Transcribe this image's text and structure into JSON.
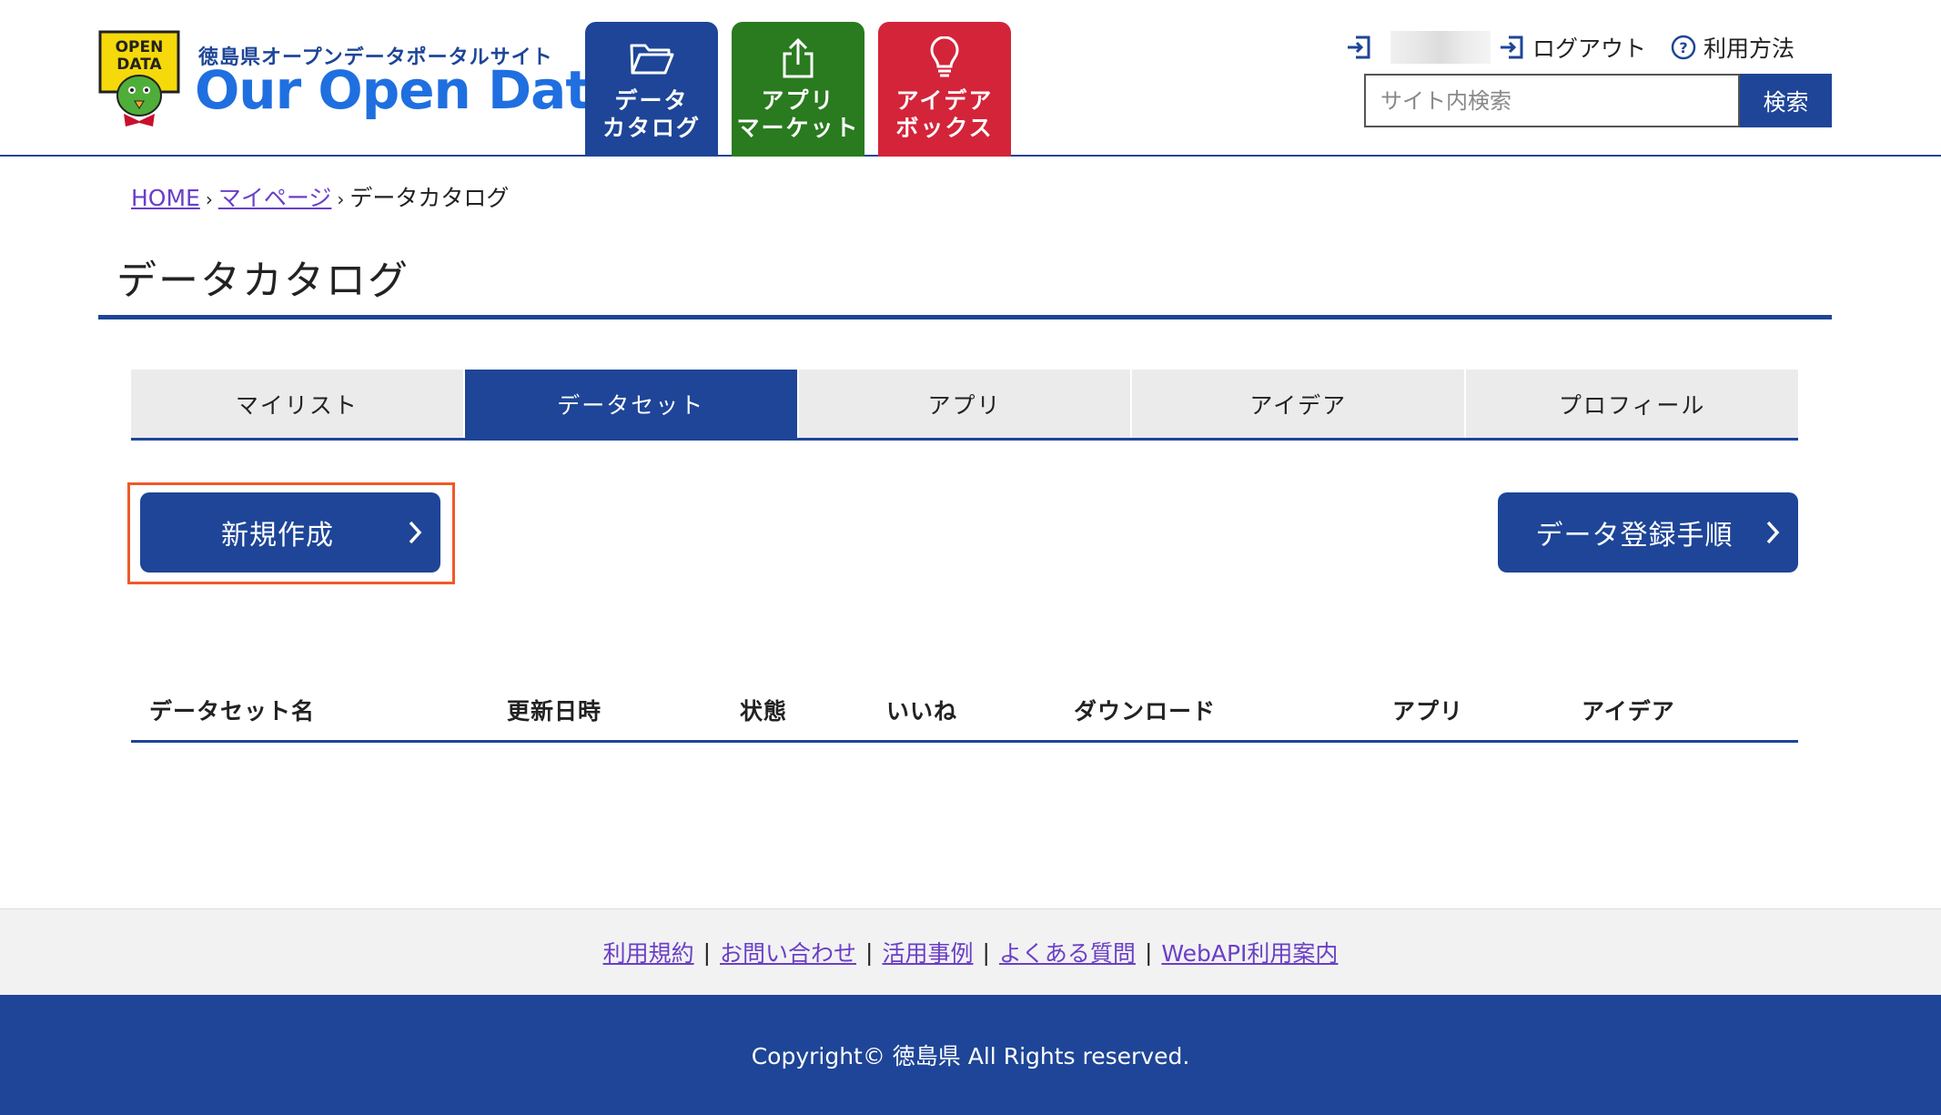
{
  "header": {
    "mascot_badge_line1": "OPEN",
    "mascot_badge_line2": "DATA",
    "site_subtitle": "徳島県オープンデータポータルサイト",
    "site_title": "Our Open Data",
    "nav": [
      {
        "label": "データ\nカタログ",
        "icon": "folder-icon",
        "color": "#1e4597"
      },
      {
        "label": "アプリ\nマーケット",
        "icon": "share-icon",
        "color": "#2a7a1f"
      },
      {
        "label": "アイデア\nボックス",
        "icon": "lightbulb-icon",
        "color": "#d3243a"
      }
    ],
    "logout_label": "ログアウト",
    "help_label": "利用方法",
    "search_placeholder": "サイト内検索",
    "search_button": "検索"
  },
  "breadcrumb": {
    "home": "HOME",
    "mypage": "マイページ",
    "current": "データカタログ",
    "separator": "›"
  },
  "page_title": "データカタログ",
  "tabs": [
    {
      "label": "マイリスト",
      "active": false
    },
    {
      "label": "データセット",
      "active": true
    },
    {
      "label": "アプリ",
      "active": false
    },
    {
      "label": "アイデア",
      "active": false
    },
    {
      "label": "プロフィール",
      "active": false
    }
  ],
  "buttons": {
    "new_label": "新規作成",
    "guide_label": "データ登録手順"
  },
  "table": {
    "columns": [
      "データセット名",
      "更新日時",
      "状態",
      "いいね",
      "ダウンロード",
      "アプリ",
      "アイデア"
    ]
  },
  "footer": {
    "links": [
      "利用規約",
      "お問い合わせ",
      "活用事例",
      "よくある質問",
      "WebAPI利用案内"
    ],
    "separator": "|",
    "copyright": "Copyright© 徳島県 All Rights reserved."
  },
  "colors": {
    "brand_blue": "#1e4597",
    "app_green": "#2a7a1f",
    "idea_red": "#d3243a",
    "highlight_orange": "#ee5a2a",
    "link_purple": "#6a3fc7"
  }
}
